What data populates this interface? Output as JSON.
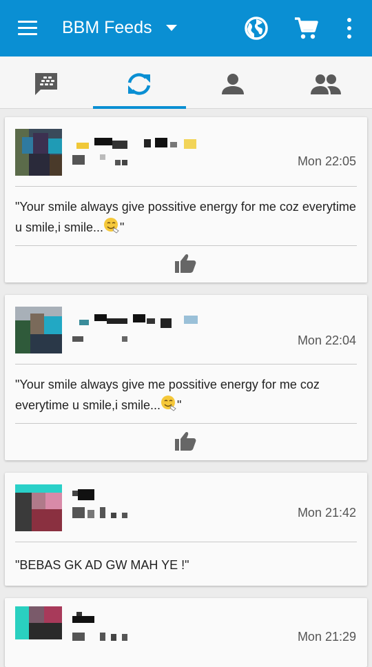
{
  "app_bar": {
    "title": "BBM Feeds",
    "icons": [
      "menu-icon",
      "caret-down-icon",
      "globe-icon",
      "cart-icon",
      "more-vert-icon"
    ],
    "color": "#0a8fd3"
  },
  "tabs": [
    {
      "icon": "bbm-chat-icon",
      "selected": false
    },
    {
      "icon": "refresh-icon",
      "selected": true
    },
    {
      "icon": "person-icon",
      "selected": false
    },
    {
      "icon": "group-icon",
      "selected": false
    }
  ],
  "feeds": [
    {
      "time": "Mon 22:05",
      "status_text": "\"Your smile always give possitive energy for me coz everytime u smile,i smile...",
      "status_end": "\"",
      "has_like": true
    },
    {
      "time": "Mon 22:04",
      "status_text": "\"Your smile always give me possitive energy for me coz everytime u smile,i smile...",
      "status_end": "\"",
      "has_like": true
    },
    {
      "time": "Mon 21:42",
      "status_text": "\"BEBAS GK AD GW MAH YE !\"",
      "status_end": "",
      "has_like": false
    },
    {
      "time": "Mon 21:29",
      "status_text": "",
      "status_end": "",
      "has_like": false
    }
  ]
}
